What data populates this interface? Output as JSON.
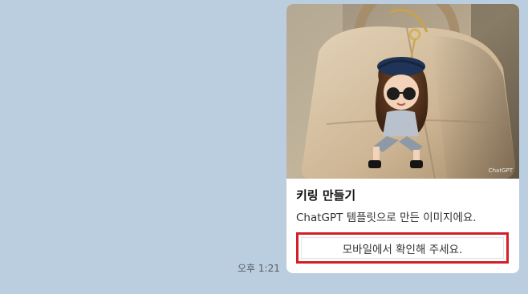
{
  "message": {
    "timestamp": "오후 1:21",
    "card": {
      "image_watermark": "ChatGPT",
      "title": "키링 만들기",
      "description": "ChatGPT 템플릿으로 만든 이미지에요.",
      "button_label": "모바일에서 확인해 주세요."
    }
  },
  "colors": {
    "chat_background": "#bacee0",
    "highlight_border": "#d31f27"
  }
}
